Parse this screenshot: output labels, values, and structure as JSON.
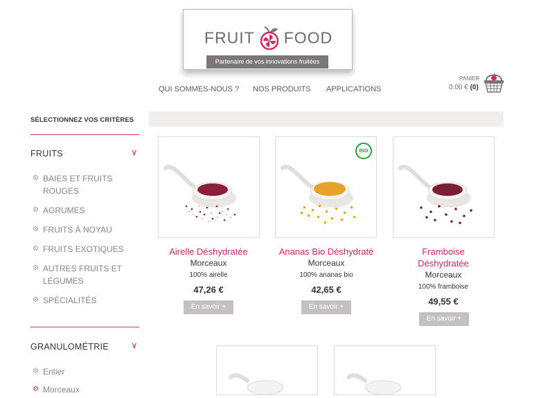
{
  "logo": {
    "word1": "FRUIT",
    "word2": "FOOD",
    "tagline": "Partenaire de vos innovations fruitées"
  },
  "nav": {
    "items": [
      "QUI SOMMES-NOUS ?",
      "NOS PRODUITS",
      "APPLICATIONS"
    ]
  },
  "cart": {
    "label": "PANIER",
    "total": "0.00 €",
    "count": "(0)",
    "icon": "basket-icon"
  },
  "sidebar": {
    "title": "SÉLECTIONNEZ VOS CRITÈRES",
    "groups": [
      {
        "title": "FRUITS",
        "items": [
          "BAIES ET FRUITS ROUGES",
          "AGRUMES",
          "FRUITS À NOYAU",
          "FRUITS EXOTIQUES",
          "AUTRES FRUITS ET LÉGUMES",
          "SPÉCIALITÉS"
        ]
      },
      {
        "title": "GRANULOMÉTRIE",
        "items": [
          "Entier",
          "Morceaux"
        ]
      }
    ]
  },
  "products": [
    {
      "name": "Airelle Déshydratée",
      "form": "Morceaux",
      "composition": "100% airelle",
      "price": "47,26 €",
      "button": "En savoir +",
      "color": "#8e1f3c"
    },
    {
      "name": "Ananas Bio Déshydraté",
      "form": "Morceaux",
      "composition": "100% ananas bio",
      "price": "42,65 €",
      "button": "En savoir +",
      "badge": "BIO",
      "color": "#e8a22a"
    },
    {
      "name_line1": "Framboise",
      "name_line2": "Déshydratée",
      "form": "Morceaux",
      "composition": "100% framboise",
      "price": "49,55 €",
      "button": "En savoir +",
      "color": "#7a1e33"
    }
  ],
  "colors": {
    "accent": "#cf2a63",
    "logo_grey": "#6e6a6a",
    "bio_green": "#2f9e45",
    "button_grey": "#c5c1c1"
  }
}
